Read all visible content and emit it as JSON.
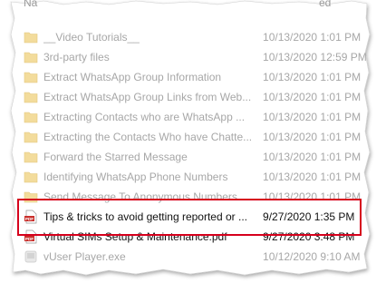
{
  "header": {
    "cut_text": "Na",
    "cut_text_right": "ed"
  },
  "rows": [
    {
      "name": "__Video Tutorials__",
      "date": "10/13/2020 1:01 PM",
      "icon": "folder-icon",
      "faded": true
    },
    {
      "name": "3rd-party files",
      "date": "10/13/2020 12:59 PM",
      "icon": "folder-icon",
      "faded": true
    },
    {
      "name": "Extract WhatsApp Group Information",
      "date": "10/13/2020 1:01 PM",
      "icon": "folder-icon",
      "faded": true
    },
    {
      "name": "Extract WhatsApp Group Links from Web...",
      "date": "10/13/2020 1:01 PM",
      "icon": "folder-icon",
      "faded": true
    },
    {
      "name": "Extracting Contacts who are WhatsApp ...",
      "date": "10/13/2020 1:01 PM",
      "icon": "folder-icon",
      "faded": true
    },
    {
      "name": "Extracting the Contacts Who have Chatte...",
      "date": "10/13/2020 1:01 PM",
      "icon": "folder-icon",
      "faded": true
    },
    {
      "name": "Forward the Starred Message",
      "date": "10/13/2020 1:01 PM",
      "icon": "folder-icon",
      "faded": true
    },
    {
      "name": "Identifying WhatsApp Phone Numbers",
      "date": "10/13/2020 1:01 PM",
      "icon": "folder-icon",
      "faded": true
    },
    {
      "name": "Send Message To Anonymous Numbers",
      "date": "10/13/2020 1:01 PM",
      "icon": "folder-icon",
      "faded": true
    },
    {
      "name": "Tips & tricks to avoid getting reported or ...",
      "date": "9/27/2020 1:35 PM",
      "icon": "pdf-icon",
      "faded": false
    },
    {
      "name": "Virtual SIMs Setup & Maintenance.pdf",
      "date": "9/27/2020 3:48 PM",
      "icon": "pdf-icon",
      "faded": false
    },
    {
      "name": "vUser Player.exe",
      "date": "10/12/2020 9:10 AM",
      "icon": "app-icon",
      "faded": true
    }
  ],
  "colors": {
    "highlight": "#d6001c",
    "folder": "#f3dc9c",
    "pdf": "#c9302c"
  }
}
